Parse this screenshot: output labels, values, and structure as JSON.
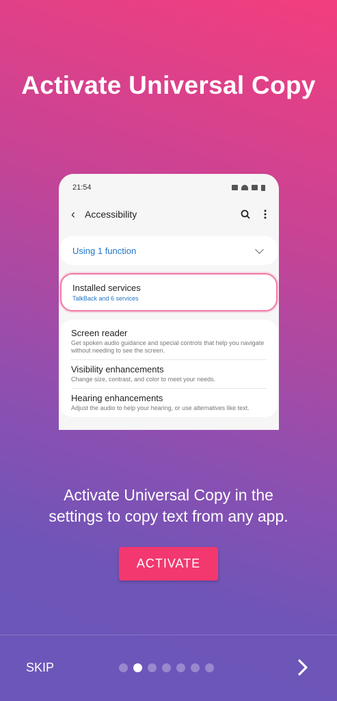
{
  "onboarding": {
    "title": "Activate Universal Copy",
    "description_line1": "Activate Universal Copy in the",
    "description_line2": "settings to copy text from any app.",
    "activate_label": "ACTIVATE",
    "skip_label": "SKIP",
    "page_count": 7,
    "current_page": 2
  },
  "phone": {
    "time": "21:54",
    "title": "Accessibility",
    "function_label": "Using 1 function",
    "installed": {
      "title": "Installed services",
      "subtitle": "TalkBack and 6 services"
    },
    "items": [
      {
        "title": "Screen reader",
        "desc": "Get spoken audio guidance and special controls that help you navigate without needing to see the screen."
      },
      {
        "title": "Visibility enhancements",
        "desc": "Change size, contrast, and color to meet your needs."
      },
      {
        "title": "Hearing enhancements",
        "desc": "Adjust the audio to help your hearing, or use alternatives like text."
      }
    ]
  },
  "colors": {
    "accent": "#f2386f",
    "link_blue": "#2175c6"
  }
}
